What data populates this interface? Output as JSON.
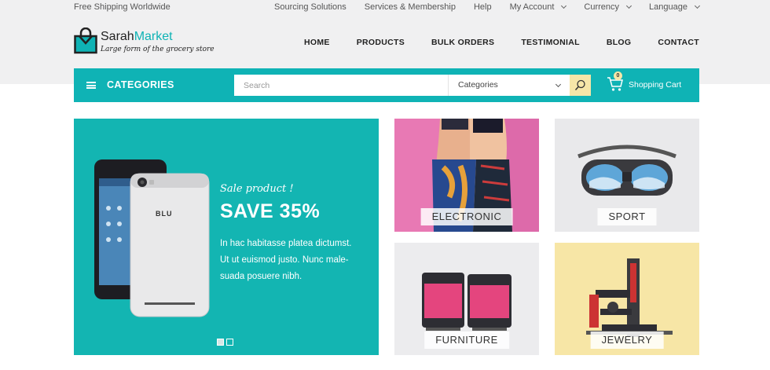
{
  "topbar": {
    "shipping": "Free Shipping Worldwide",
    "links": [
      {
        "label": "Sourcing Solutions",
        "dropdown": false
      },
      {
        "label": "Services & Membership",
        "dropdown": false
      },
      {
        "label": "Help",
        "dropdown": false
      },
      {
        "label": "My Account",
        "dropdown": true
      },
      {
        "label": "Currency",
        "dropdown": true
      },
      {
        "label": "Language",
        "dropdown": true
      }
    ]
  },
  "logo": {
    "brand_a": "Sarah",
    "brand_b": "Market",
    "tagline": "Large form of the grocery store"
  },
  "nav": [
    "HOME",
    "PRODUCTS",
    "BULK ORDERS",
    "TESTIMONIAL",
    "BLOG",
    "CONTACT"
  ],
  "searchbar": {
    "categories_label": "CATEGORIES",
    "search_placeholder": "Search",
    "category_select": "Categories",
    "cart_label": "Shopping Cart",
    "cart_count": "0"
  },
  "hero": {
    "subtitle": "Sale product !",
    "headline": "SAVE 35%",
    "desc_lines": [
      "In hac habitasse platea dictumst.",
      "Ut ut euismod justo. Nunc male-",
      "suada posuere nibh."
    ],
    "phone_brand": "BLU",
    "slides": 2,
    "active_slide": 1
  },
  "tiles": [
    {
      "label": "ELECTRONIC",
      "bg": "#e879b4"
    },
    {
      "label": "SPORT",
      "bg": "#e9e9eb"
    },
    {
      "label": "FURNITURE",
      "bg": "#ececee"
    },
    {
      "label": "JEWELRY",
      "bg": "#f7e6a6"
    }
  ],
  "colors": {
    "accent": "#0fb3b5",
    "highlight": "#f6e6a8",
    "header_bg": "#f0f0f1"
  }
}
